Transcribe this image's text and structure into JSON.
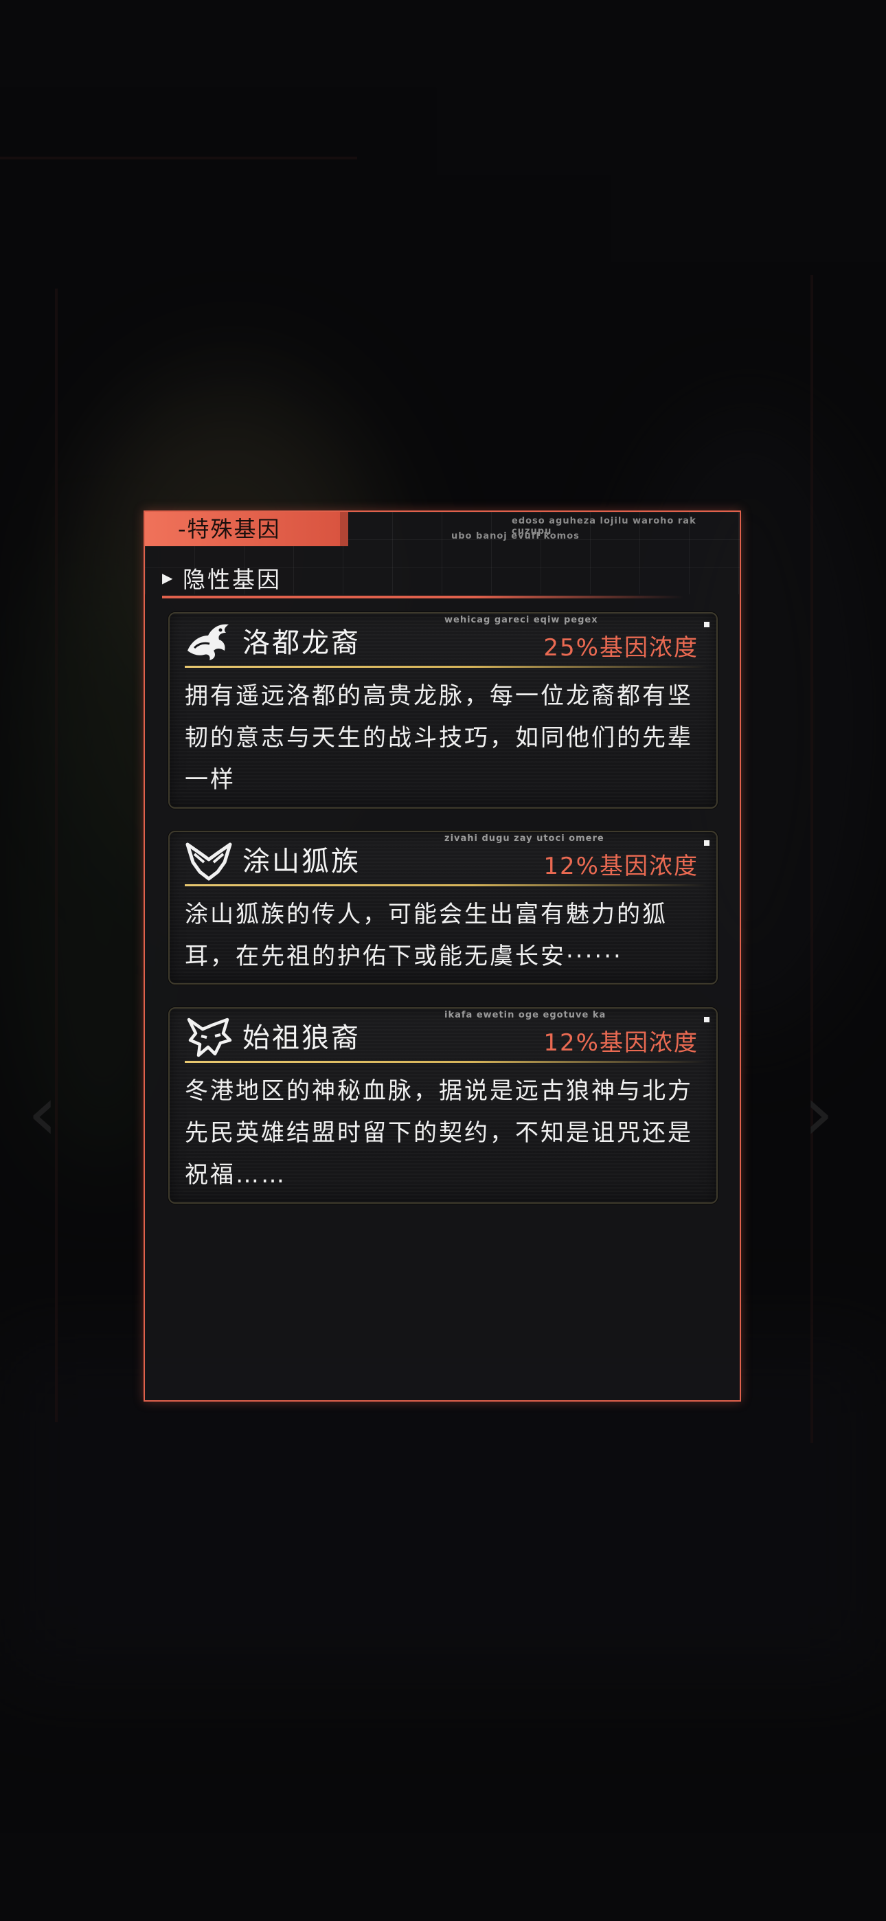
{
  "panel": {
    "header_tab": "-特殊基因",
    "deco_code_1": "edoso aguheza lojilu waroho rak cuzupu",
    "deco_code_2": "ubo banoj evufl komos",
    "section_label": "隐性基因",
    "accent_color": "#e0614c",
    "gold_color": "#d6b45a"
  },
  "genes": [
    {
      "icon": "dragon-icon",
      "code": "wehicag gareci eqiw pegex",
      "name": "洛都龙裔",
      "concentration": "25%基因浓度",
      "description": "拥有遥远洛都的高贵龙脉，每一位龙裔都有坚韧的意志与天生的战斗技巧，如同他们的先辈一样"
    },
    {
      "icon": "fox-icon",
      "code": "zivahi dugu zay utoci omere",
      "name": "涂山狐族",
      "concentration": "12%基因浓度",
      "description": "涂山狐族的传人，可能会生出富有魅力的狐耳，在先祖的护佑下或能无虞长安······"
    },
    {
      "icon": "wolf-icon",
      "code": "ikafa ewetin oge egotuve ka",
      "name": "始祖狼裔",
      "concentration": "12%基因浓度",
      "description": "冬港地区的神秘血脉，据说是远古狼神与北方先民英雄结盟时留下的契约，不知是诅咒还是祝福……"
    }
  ]
}
